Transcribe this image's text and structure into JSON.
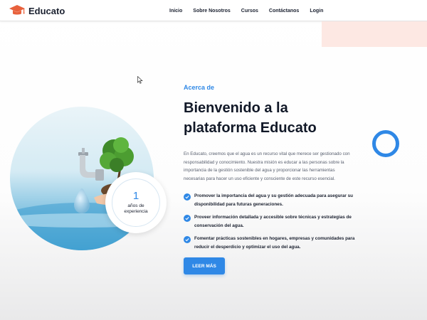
{
  "brand": {
    "name": "Educato",
    "accent": "#2f88e6",
    "dark": "#1b2130",
    "logo_icon": "graduation-cap-icon",
    "logo_color": "#e8613c"
  },
  "nav": {
    "items": [
      {
        "label": "Inicio"
      },
      {
        "label": "Sobre Nosotros"
      },
      {
        "label": "Cursos"
      },
      {
        "label": "Contáctanos"
      },
      {
        "label": "Login"
      }
    ]
  },
  "about": {
    "eyebrow": "Acerca de",
    "heading": "Bienvenido a la plataforma Educato",
    "paragraph": "En Educato, creemos que el agua es un recurso vital que merece ser gestionado con responsabilidad y conocimiento. Nuestra misión es educar a las personas sobre la importancia de la gestión sostenible del agua y proporcionar las herramientas necesarias para hacer un uso eficiente y consciente de este recurso esencial.",
    "points": [
      {
        "icon": "check-circle-icon",
        "text": "Promover la importancia del agua y su gestión adecuada para asegurar su disponibilidad para futuras generaciones."
      },
      {
        "icon": "check-circle-icon",
        "text": "Proveer información detallada y accesible sobre técnicas y estrategias de conservación del agua."
      },
      {
        "icon": "check-circle-icon",
        "text": "Fomentar prácticas sostenibles en hogares, empresas y comunidades para reducir el desperdicio y optimizar el uso del agua."
      }
    ],
    "button_label": "LEER MÁS",
    "experience": {
      "number": "1",
      "label": "años de experiencia"
    },
    "image": "faucet-tree-water-image"
  },
  "decor": {
    "ring_icon": "ring-decoration-icon",
    "cursor_icon": "mouse-cursor-icon"
  }
}
